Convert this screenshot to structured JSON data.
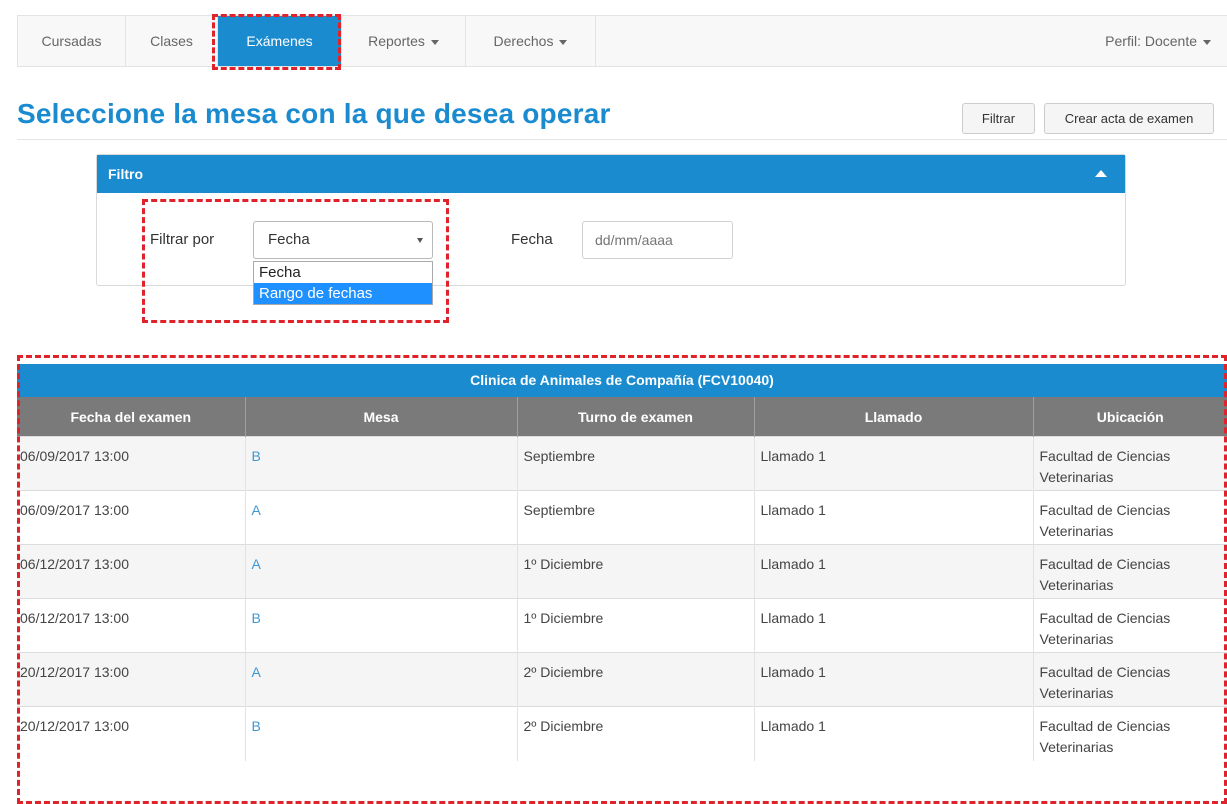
{
  "nav": {
    "items": [
      {
        "label": "Cursadas"
      },
      {
        "label": "Clases"
      },
      {
        "label": "Exámenes"
      },
      {
        "label": "Reportes"
      },
      {
        "label": "Derechos"
      }
    ],
    "profile": "Perfil: Docente"
  },
  "header": {
    "title": "Seleccione la mesa con la que desea operar",
    "filter_button": "Filtrar",
    "create_button": "Crear acta de examen"
  },
  "filter": {
    "title": "Filtro",
    "filter_by_label": "Filtrar por",
    "selected": "Fecha",
    "options": [
      "Fecha",
      "Rango de fechas"
    ],
    "date_label": "Fecha",
    "date_placeholder": "dd/mm/aaaa"
  },
  "table": {
    "title": "Clinica de Animales de Compañía (FCV10040)",
    "columns": [
      "Fecha del examen",
      "Mesa",
      "Turno de examen",
      "Llamado",
      "Ubicación"
    ],
    "rows": [
      {
        "fecha": "06/09/2017 13:00",
        "mesa": "B",
        "turno": "Septiembre",
        "llamado": "Llamado 1",
        "ubicacion": "Facultad de Ciencias Veterinarias"
      },
      {
        "fecha": "06/09/2017 13:00",
        "mesa": "A",
        "turno": "Septiembre",
        "llamado": "Llamado 1",
        "ubicacion": "Facultad de Ciencias Veterinarias"
      },
      {
        "fecha": "06/12/2017 13:00",
        "mesa": "A",
        "turno": "1º Diciembre",
        "llamado": "Llamado 1",
        "ubicacion": "Facultad de Ciencias Veterinarias"
      },
      {
        "fecha": "06/12/2017 13:00",
        "mesa": "B",
        "turno": "1º Diciembre",
        "llamado": "Llamado 1",
        "ubicacion": "Facultad de Ciencias Veterinarias"
      },
      {
        "fecha": "20/12/2017 13:00",
        "mesa": "A",
        "turno": "2º Diciembre",
        "llamado": "Llamado 1",
        "ubicacion": "Facultad de Ciencias Veterinarias"
      },
      {
        "fecha": "20/12/2017 13:00",
        "mesa": "B",
        "turno": "2º Diciembre",
        "llamado": "Llamado 1",
        "ubicacion": "Facultad de Ciencias Veterinarias"
      }
    ]
  },
  "colors": {
    "accent": "#1b8bd0",
    "highlight_dash": "#e0232b",
    "table_header": "#7a7a7a"
  }
}
